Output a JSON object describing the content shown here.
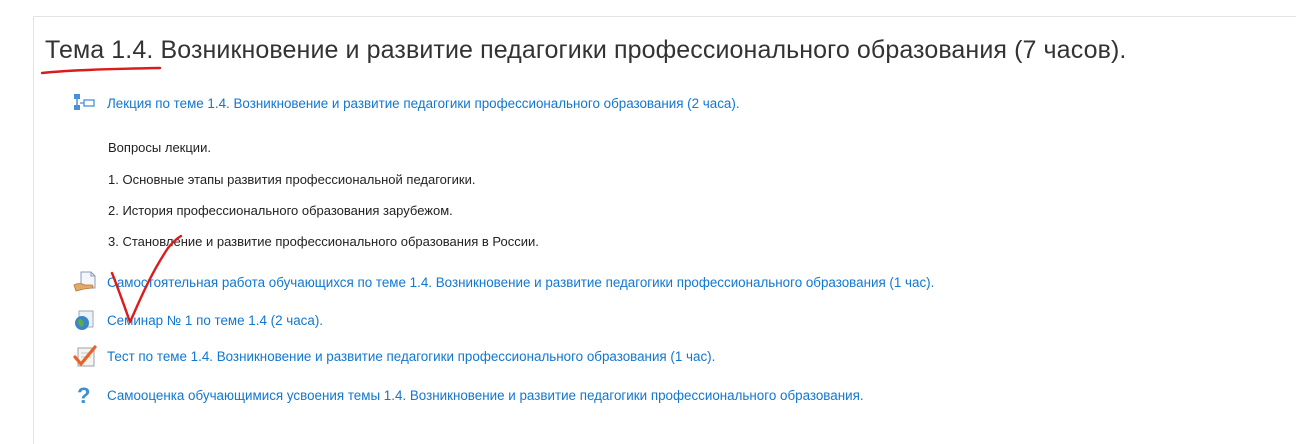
{
  "section": {
    "title": "Тема 1.4. Возникновение и развитие педагогики профессионального образования (7 часов)."
  },
  "activities": [
    {
      "label": "Лекция по теме 1.4. Возникновение и развитие педагогики профессионального образования (2 часа).",
      "icon": "book-icon"
    },
    {
      "label": "Самостоятельная работа обучающихся по теме 1.4. Возникновение и развитие педагогики профессионального образования (1 час).",
      "icon": "assignment-icon"
    },
    {
      "label": "Семинар № 1 по теме 1.4 (2 часа).",
      "icon": "globe-icon"
    },
    {
      "label": "Тест по теме 1.4. Возникновение и развитие педагогики профессионального образования (1 час).",
      "icon": "quiz-icon"
    },
    {
      "label": "Самооценка обучающимися усвоения темы 1.4. Возникновение и развитие педагогики профессионального образования.",
      "icon": "question-icon"
    }
  ],
  "lecture_summary": {
    "heading": "Вопросы лекции.",
    "items": [
      "1. Основные этапы развития профессиональной педагогики.",
      "2. История профессионального образования зарубежом.",
      "3. Становление и развитие профессионального образования в России."
    ]
  },
  "colors": {
    "link": "#1177d1",
    "text": "#333333",
    "annotation": "#d91c1c"
  }
}
